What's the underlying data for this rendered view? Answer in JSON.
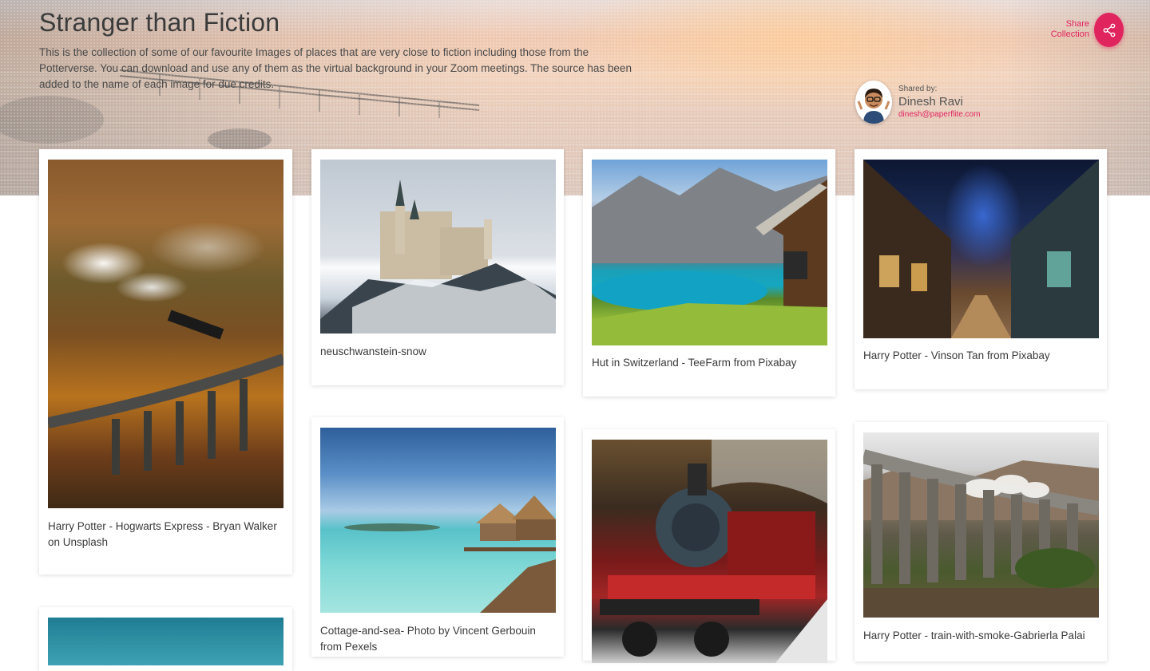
{
  "collection": {
    "title": "Stranger than Fiction",
    "description": "This is the collection of some of our favourite Images of places that are very close to fiction including those from the Potterverse. You can download and use any of them as the virtual background in your Zoom meetings. The source has been added to the name of each image for due credits."
  },
  "share": {
    "line1": "Share",
    "line2": "Collection",
    "icon": "share-icon"
  },
  "sharer": {
    "shared_by_label": "Shared by:",
    "name": "Dinesh Ravi",
    "email": "dinesh@paperflite.com"
  },
  "cards": [
    {
      "caption": "Harry Potter - Hogwarts Express - Bryan Walker on Unsplash"
    },
    {
      "caption": "neuschwanstein-snow"
    },
    {
      "caption": "Hut in Switzerland - TeeFarm from Pixabay"
    },
    {
      "caption": "Harry Potter - Vinson Tan from Pixabay"
    },
    {
      "caption": "Cottage-and-sea- Photo by Vincent Gerbouin from Pexels"
    },
    {
      "caption": ""
    },
    {
      "caption": "Harry Potter - train-with-smoke-Gabrierla Palai"
    },
    {
      "caption": ""
    }
  ],
  "colors": {
    "accent": "#e0245e",
    "text": "#3b3b3b"
  }
}
